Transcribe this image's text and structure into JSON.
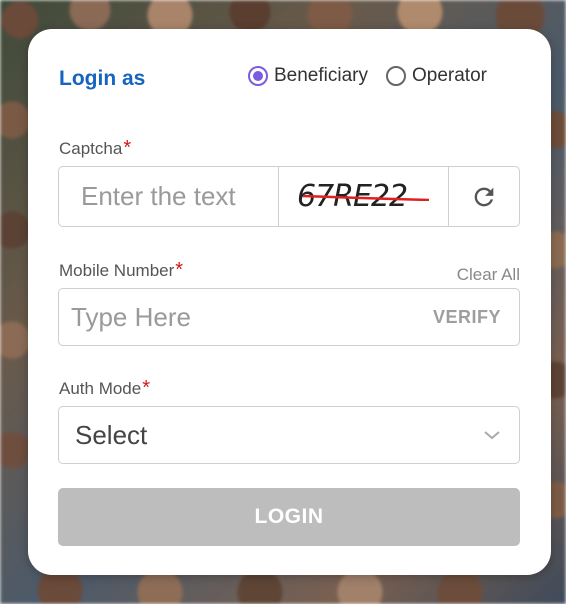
{
  "login": {
    "title": "Login as",
    "roles": [
      {
        "label": "Beneficiary",
        "selected": true
      },
      {
        "label": "Operator",
        "selected": false
      }
    ]
  },
  "captcha": {
    "label": "Captcha",
    "required_mark": "*",
    "placeholder": "Enter the text",
    "code": "67RE22",
    "refresh_icon": "refresh-icon"
  },
  "mobile": {
    "label": "Mobile Number",
    "required_mark": "*",
    "clear_all": "Clear All",
    "placeholder": "Type Here",
    "verify": "VERIFY"
  },
  "auth_mode": {
    "label": "Auth Mode",
    "required_mark": "*",
    "selected": "Select"
  },
  "submit": {
    "label": "LOGIN"
  },
  "colors": {
    "accent": "#1565c0",
    "radio_selected": "#7b5ce0",
    "required": "#d01818",
    "button_disabled": "#bdbdbd"
  }
}
